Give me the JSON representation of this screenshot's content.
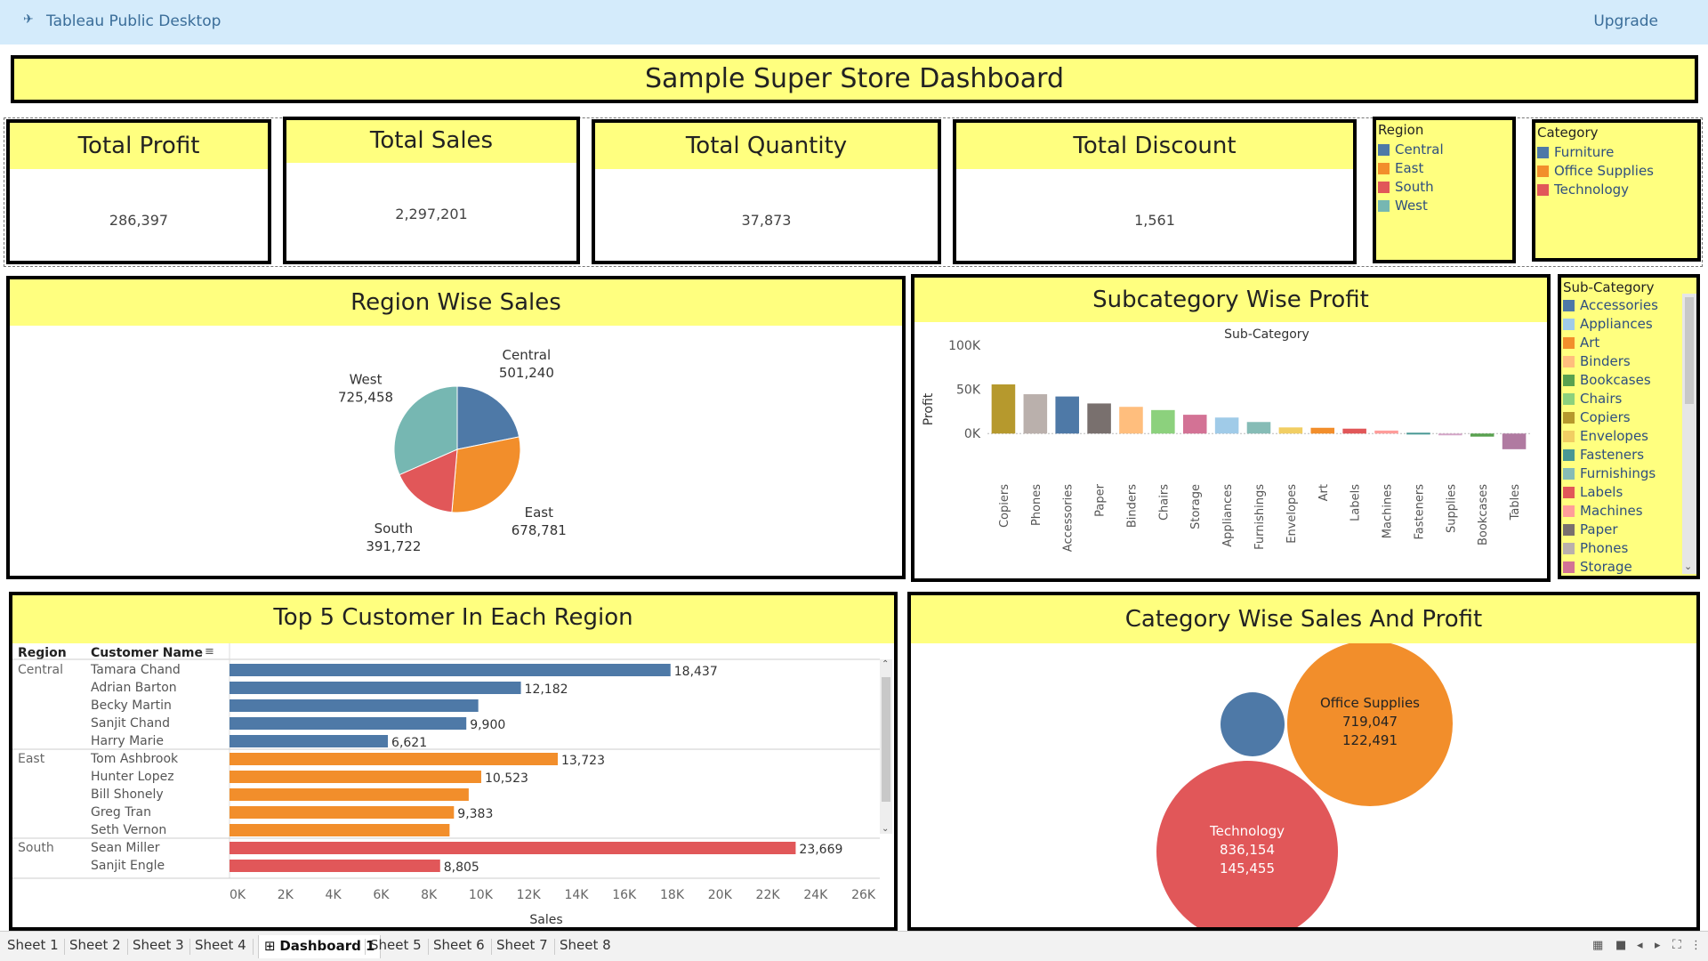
{
  "app": {
    "title": "Tableau Public Desktop",
    "upgrade": "Upgrade"
  },
  "dashboard": {
    "title": "Sample Super Store Dashboard"
  },
  "kpis": [
    {
      "label": "Total Profit",
      "value": "286,397"
    },
    {
      "label": "Total Sales",
      "value": "2,297,201"
    },
    {
      "label": "Total Quantity",
      "value": "37,873"
    },
    {
      "label": "Total Discount",
      "value": "1,561"
    }
  ],
  "legend_region": {
    "title": "Region",
    "items": [
      {
        "label": "Central",
        "color": "#4e79a7"
      },
      {
        "label": "East",
        "color": "#f28e2b"
      },
      {
        "label": "South",
        "color": "#e15759"
      },
      {
        "label": "West",
        "color": "#76b7b2"
      }
    ]
  },
  "legend_category": {
    "title": "Category",
    "items": [
      {
        "label": "Furniture",
        "color": "#4e79a7"
      },
      {
        "label": "Office Supplies",
        "color": "#f28e2b"
      },
      {
        "label": "Technology",
        "color": "#e15759"
      }
    ]
  },
  "legend_subcategory": {
    "title": "Sub-Category",
    "items": [
      {
        "label": "Accessories",
        "color": "#4e79a7"
      },
      {
        "label": "Appliances",
        "color": "#a0cbe8"
      },
      {
        "label": "Art",
        "color": "#f28e2b"
      },
      {
        "label": "Binders",
        "color": "#ffbe7d"
      },
      {
        "label": "Bookcases",
        "color": "#59a14f"
      },
      {
        "label": "Chairs",
        "color": "#8cd17d"
      },
      {
        "label": "Copiers",
        "color": "#b6992d"
      },
      {
        "label": "Envelopes",
        "color": "#f1ce63"
      },
      {
        "label": "Fasteners",
        "color": "#499894"
      },
      {
        "label": "Furnishings",
        "color": "#86bcb6"
      },
      {
        "label": "Labels",
        "color": "#e15759"
      },
      {
        "label": "Machines",
        "color": "#ff9d9a"
      },
      {
        "label": "Paper",
        "color": "#79706e"
      },
      {
        "label": "Phones",
        "color": "#bab0ac"
      },
      {
        "label": "Storage",
        "color": "#d37295"
      }
    ]
  },
  "region_pie": {
    "title": "Region Wise Sales",
    "chart_data": {
      "type": "pie",
      "slices": [
        {
          "label": "Central",
          "value": 501240,
          "value_label": "501,240",
          "color": "#4e79a7"
        },
        {
          "label": "East",
          "value": 678781,
          "value_label": "678,781",
          "color": "#f28e2b"
        },
        {
          "label": "South",
          "value": 391722,
          "value_label": "391,722",
          "color": "#e15759"
        },
        {
          "label": "West",
          "value": 725458,
          "value_label": "725,458",
          "color": "#76b7b2"
        }
      ]
    }
  },
  "subcat_profit": {
    "title": "Subcategory Wise Profit",
    "chart_data": {
      "type": "bar",
      "xlabel": "Sub-Category",
      "ylabel": "Profit",
      "ylim": [
        -35000,
        110000
      ],
      "ticks": [
        {
          "value": 100000,
          "label": "100K"
        },
        {
          "value": 50000,
          "label": "50K"
        },
        {
          "value": 0,
          "label": "0K"
        }
      ],
      "categories": [
        "Copiers",
        "Phones",
        "Accessories",
        "Paper",
        "Binders",
        "Chairs",
        "Storage",
        "Appliances",
        "Furnishings",
        "Envelopes",
        "Art",
        "Labels",
        "Machines",
        "Fasteners",
        "Supplies",
        "Bookcases",
        "Tables"
      ],
      "values": [
        55618,
        44516,
        41937,
        34054,
        30222,
        26590,
        21279,
        18138,
        13059,
        6964,
        6528,
        5546,
        3385,
        950,
        -1189,
        -3473,
        -17725
      ],
      "colors": [
        "#b6992d",
        "#bab0ac",
        "#4e79a7",
        "#79706e",
        "#ffbe7d",
        "#8cd17d",
        "#d37295",
        "#a0cbe8",
        "#86bcb6",
        "#f1ce63",
        "#f28e2b",
        "#e15759",
        "#ff9d9a",
        "#499894",
        "#d4a6c8",
        "#59a14f",
        "#b07aa1"
      ]
    }
  },
  "top_customers": {
    "title": "Top 5 Customer In Each Region",
    "col_region": "Region",
    "col_customer": "Customer Name",
    "chart_data": {
      "type": "bar",
      "xlabel": "Sales",
      "xlim": [
        0,
        27000
      ],
      "ticks": [
        "0K",
        "2K",
        "4K",
        "6K",
        "8K",
        "10K",
        "12K",
        "14K",
        "16K",
        "18K",
        "20K",
        "22K",
        "24K",
        "26K"
      ],
      "groups": [
        {
          "region": "Central",
          "color": "#4e79a7",
          "rows": [
            {
              "name": "Tamara Chand",
              "value": 18437,
              "label": "18,437"
            },
            {
              "name": "Adrian Barton",
              "value": 12182,
              "label": "12,182"
            },
            {
              "name": "Becky Martin",
              "value": 10400,
              "label": ""
            },
            {
              "name": "Sanjit Chand",
              "value": 9900,
              "label": "9,900"
            },
            {
              "name": "Harry Marie",
              "value": 6621,
              "label": "6,621"
            }
          ]
        },
        {
          "region": "East",
          "color": "#f28e2b",
          "rows": [
            {
              "name": "Tom Ashbrook",
              "value": 13723,
              "label": "13,723"
            },
            {
              "name": "Hunter Lopez",
              "value": 10523,
              "label": "10,523"
            },
            {
              "name": "Bill Shonely",
              "value": 10000,
              "label": ""
            },
            {
              "name": "Greg Tran",
              "value": 9383,
              "label": "9,383"
            },
            {
              "name": "Seth Vernon",
              "value": 9200,
              "label": ""
            }
          ]
        },
        {
          "region": "South",
          "color": "#e15759",
          "rows": [
            {
              "name": "Sean Miller",
              "value": 23669,
              "label": "23,669"
            },
            {
              "name": "Sanjit Engle",
              "value": 8805,
              "label": "8,805"
            }
          ]
        }
      ]
    }
  },
  "category_bubble": {
    "title": "Category Wise Sales And Profit",
    "chart_data": {
      "type": "scatter",
      "bubbles": [
        {
          "label": "Furniture",
          "sales": 742000,
          "profit": 18451,
          "color": "#4e79a7",
          "show_text": false
        },
        {
          "label": "Office Supplies",
          "sales": 719047,
          "profit": 122491,
          "sales_label": "719,047",
          "profit_label": "122,491",
          "color": "#f28e2b",
          "show_text": true
        },
        {
          "label": "Technology",
          "sales": 836154,
          "profit": 145455,
          "sales_label": "836,154",
          "profit_label": "145,455",
          "color": "#e15759",
          "show_text": true
        }
      ]
    }
  },
  "tabs": [
    {
      "label": "Sheet 1",
      "active": false
    },
    {
      "label": "Sheet 2",
      "active": false
    },
    {
      "label": "Sheet 3",
      "active": false
    },
    {
      "label": "Sheet 4",
      "active": false
    },
    {
      "label": "Dashboard 1",
      "active": true
    },
    {
      "label": "Sheet 5",
      "active": false
    },
    {
      "label": "Sheet 6",
      "active": false
    },
    {
      "label": "Sheet 7",
      "active": false
    },
    {
      "label": "Sheet 8",
      "active": false
    }
  ]
}
